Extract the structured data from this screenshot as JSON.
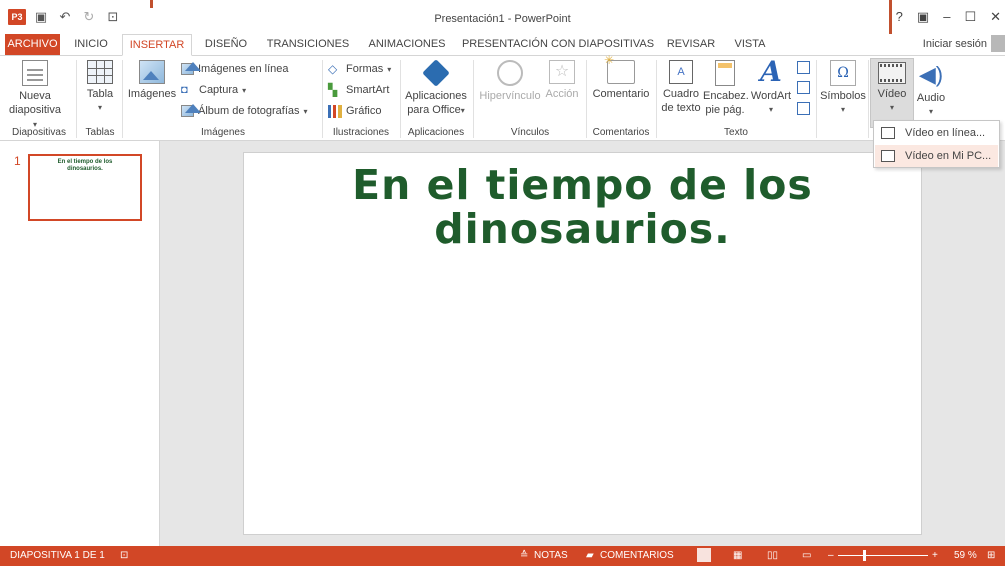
{
  "titlebar": {
    "app_icon": "P3",
    "title": "Presentación1 - PowerPoint",
    "qat_icons": [
      "save-icon",
      "undo-icon",
      "redo-icon",
      "presentation-start-icon"
    ],
    "window_controls": [
      "?",
      "▣",
      "–",
      "☐",
      "✕"
    ]
  },
  "tabs": [
    {
      "label": "ARCHIVO"
    },
    {
      "label": "INICIO"
    },
    {
      "label": "INSERTAR"
    },
    {
      "label": "DISEÑO"
    },
    {
      "label": "TRANSICIONES"
    },
    {
      "label": "ANIMACIONES"
    },
    {
      "label": "PRESENTACIÓN CON DIAPOSITIVAS"
    },
    {
      "label": "REVISAR"
    },
    {
      "label": "VISTA"
    }
  ],
  "signin": "Iniciar sesión",
  "ribbon": {
    "diapositivas": {
      "button": "Nueva diapositiva",
      "line1": "Nueva",
      "line2": "diapositiva",
      "group": "Diapositivas"
    },
    "tablas": {
      "button": "Tabla",
      "group": "Tablas"
    },
    "imagenes": {
      "big": "Imágenes",
      "online": "Imágenes en línea",
      "captura": "Captura",
      "album": "Álbum de fotografías",
      "group": "Imágenes"
    },
    "ilustraciones": {
      "formas": "Formas",
      "smartart": "SmartArt",
      "grafico": "Gráfico",
      "group": "Ilustraciones"
    },
    "aplicaciones": {
      "line1": "Aplicaciones",
      "line2": "para Office",
      "group": "Aplicaciones"
    },
    "vinculos": {
      "hipervinculo": "Hipervínculo",
      "accion": "Acción",
      "group": "Vínculos"
    },
    "comentarios": {
      "comentario": "Comentario",
      "group": "Comentarios"
    },
    "texto": {
      "cuadro1": "Cuadro",
      "cuadro2": "de texto",
      "encab1": "Encabez.",
      "encab2": "pie pág.",
      "wordart": "WordArt",
      "group": "Texto"
    },
    "simbolos": {
      "label": "Símbolos"
    },
    "multimedia": {
      "video": "Vídeo",
      "audio": "Audio"
    }
  },
  "video_menu": [
    {
      "label": "Vídeo en línea...",
      "icon": "online-video-icon"
    },
    {
      "label": "Vídeo en Mi PC...",
      "icon": "pc-video-icon"
    }
  ],
  "slides": {
    "thumb_number": "1",
    "thumb_line1": "En el tiempo de los",
    "thumb_line2": "dinosaurios."
  },
  "slide": {
    "title_line1": "En el tiempo de los",
    "title_line2": "dinosaurios."
  },
  "status": {
    "slide_info": "DIAPOSITIVA 1 DE 1",
    "notas": "NOTAS",
    "comentarios": "COMENTARIOS",
    "zoom_minus": "–",
    "zoom_plus": "+",
    "zoom": "59 %"
  },
  "colors": {
    "accent": "#d24726",
    "slide_title": "#1f5c2c"
  }
}
